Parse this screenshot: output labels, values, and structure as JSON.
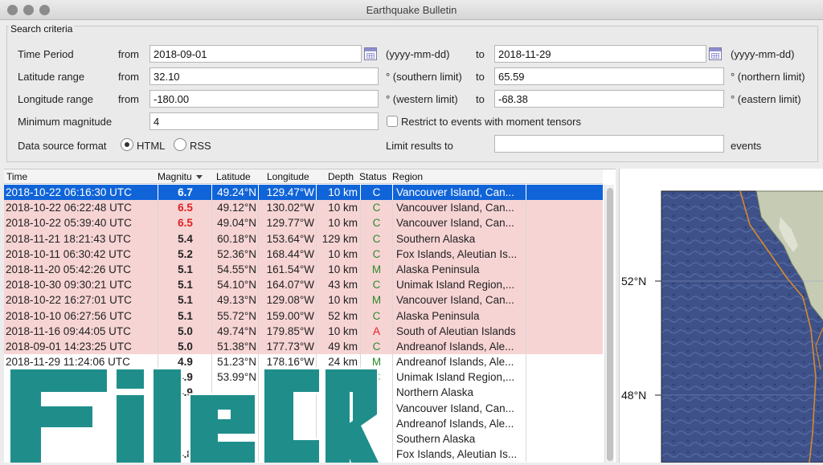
{
  "window": {
    "title": "Earthquake Bulletin"
  },
  "criteria": {
    "title": "Search criteria",
    "time_period": {
      "label": "Time Period",
      "from_label": "from",
      "from": "2018-09-01",
      "from_hint": "(yyyy-mm-dd)",
      "to_label": "to",
      "to": "2018-11-29",
      "to_hint": "(yyyy-mm-dd)"
    },
    "latitude": {
      "label": "Latitude range",
      "from_label": "from",
      "from": "32.10",
      "from_hint": "° (southern limit)",
      "to_label": "to",
      "to": "65.59",
      "to_hint": "° (northern limit)"
    },
    "longitude": {
      "label": "Longitude range",
      "from_label": "from",
      "from": "-180.00",
      "from_hint": "° (western limit)",
      "to_label": "to",
      "to": "-68.38",
      "to_hint": "° (eastern limit)"
    },
    "min_magnitude": {
      "label": "Minimum magnitude",
      "value": "4"
    },
    "moment_tensors": {
      "label": "Restrict to events with moment tensors",
      "checked": false
    },
    "data_source": {
      "label": "Data source format",
      "options": [
        "HTML",
        "RSS"
      ],
      "selected": "HTML"
    },
    "limit": {
      "label": "Limit results to",
      "value": "",
      "suffix": "events"
    }
  },
  "table": {
    "headers": {
      "time": "Time",
      "magnitude": "Magnitu",
      "latitude": "Latitude",
      "longitude": "Longitude",
      "depth": "Depth",
      "status": "Status",
      "region": "Region"
    },
    "rows": [
      {
        "time": "2018-10-22 06:16:30 UTC",
        "mag": "6.7",
        "lat": "49.24°N",
        "lon": "129.47°W",
        "depth": "10 km",
        "status": "C",
        "region": "Vancouver Island, Can...",
        "selected": true
      },
      {
        "time": "2018-10-22 06:22:48 UTC",
        "mag": "6.5",
        "lat": "49.12°N",
        "lon": "130.02°W",
        "depth": "10 km",
        "status": "C",
        "region": "Vancouver Island, Can...",
        "big": true
      },
      {
        "time": "2018-10-22 05:39:40 UTC",
        "mag": "6.5",
        "lat": "49.04°N",
        "lon": "129.77°W",
        "depth": "10 km",
        "status": "C",
        "region": "Vancouver Island, Can...",
        "big": true
      },
      {
        "time": "2018-11-21 18:21:43 UTC",
        "mag": "5.4",
        "lat": "60.18°N",
        "lon": "153.64°W",
        "depth": "129 km",
        "status": "C",
        "region": "Southern Alaska",
        "shade": true
      },
      {
        "time": "2018-10-11 06:30:42 UTC",
        "mag": "5.2",
        "lat": "52.36°N",
        "lon": "168.44°W",
        "depth": "10 km",
        "status": "C",
        "region": "Fox Islands, Aleutian Is...",
        "shade": true
      },
      {
        "time": "2018-11-20 05:42:26 UTC",
        "mag": "5.1",
        "lat": "54.55°N",
        "lon": "161.54°W",
        "depth": "10 km",
        "status": "M",
        "region": "Alaska Peninsula",
        "shade": true
      },
      {
        "time": "2018-10-30 09:30:21 UTC",
        "mag": "5.1",
        "lat": "54.10°N",
        "lon": "164.07°W",
        "depth": "43 km",
        "status": "C",
        "region": "Unimak Island Region,...",
        "shade": true
      },
      {
        "time": "2018-10-22 16:27:01 UTC",
        "mag": "5.1",
        "lat": "49.13°N",
        "lon": "129.08°W",
        "depth": "10 km",
        "status": "M",
        "region": "Vancouver Island, Can...",
        "shade": true
      },
      {
        "time": "2018-10-10 06:27:56 UTC",
        "mag": "5.1",
        "lat": "55.72°N",
        "lon": "159.00°W",
        "depth": "52 km",
        "status": "C",
        "region": "Alaska Peninsula",
        "shade": true
      },
      {
        "time": "2018-11-16 09:44:05 UTC",
        "mag": "5.0",
        "lat": "49.74°N",
        "lon": "179.85°W",
        "depth": "10 km",
        "status": "A",
        "region": "South of Aleutian Islands",
        "shade": true
      },
      {
        "time": "2018-09-01 14:23:25 UTC",
        "mag": "5.0",
        "lat": "51.38°N",
        "lon": "177.73°W",
        "depth": "49 km",
        "status": "C",
        "region": "Andreanof Islands, Ale...",
        "shade": true
      },
      {
        "time": "2018-11-29 11:24:06 UTC",
        "mag": "4.9",
        "lat": "51.23°N",
        "lon": "178.16°W",
        "depth": "24 km",
        "status": "M",
        "region": "Andreanof Islands, Ale..."
      },
      {
        "time": "",
        "mag": "4.9",
        "lat": "53.99°N",
        "lon": "",
        "depth": "",
        "status": "C",
        "region": "Unimak Island Region,..."
      },
      {
        "time": "",
        "mag": "4.9",
        "lat": "",
        "lon": "",
        "depth": "",
        "status": "",
        "region": "Northern Alaska"
      },
      {
        "time": "",
        "mag": "",
        "lat": "",
        "lon": "",
        "depth": "",
        "status": "",
        "region": "Vancouver Island, Can..."
      },
      {
        "time": "",
        "mag": "",
        "lat": "",
        "lon": "",
        "depth": "",
        "status": "",
        "region": "Andreanof Islands, Ale..."
      },
      {
        "time": "",
        "mag": "",
        "lat": "",
        "lon": "",
        "depth": "",
        "status": "",
        "region": "Southern Alaska"
      },
      {
        "time": "",
        "mag": "4.8",
        "lat": "",
        "lon": "",
        "depth": "",
        "status": "",
        "region": "Fox Islands, Aleutian Is..."
      }
    ]
  },
  "map": {
    "lat_labels": [
      "52°N",
      "48°N"
    ]
  },
  "watermark": {
    "text": "FileCR"
  }
}
